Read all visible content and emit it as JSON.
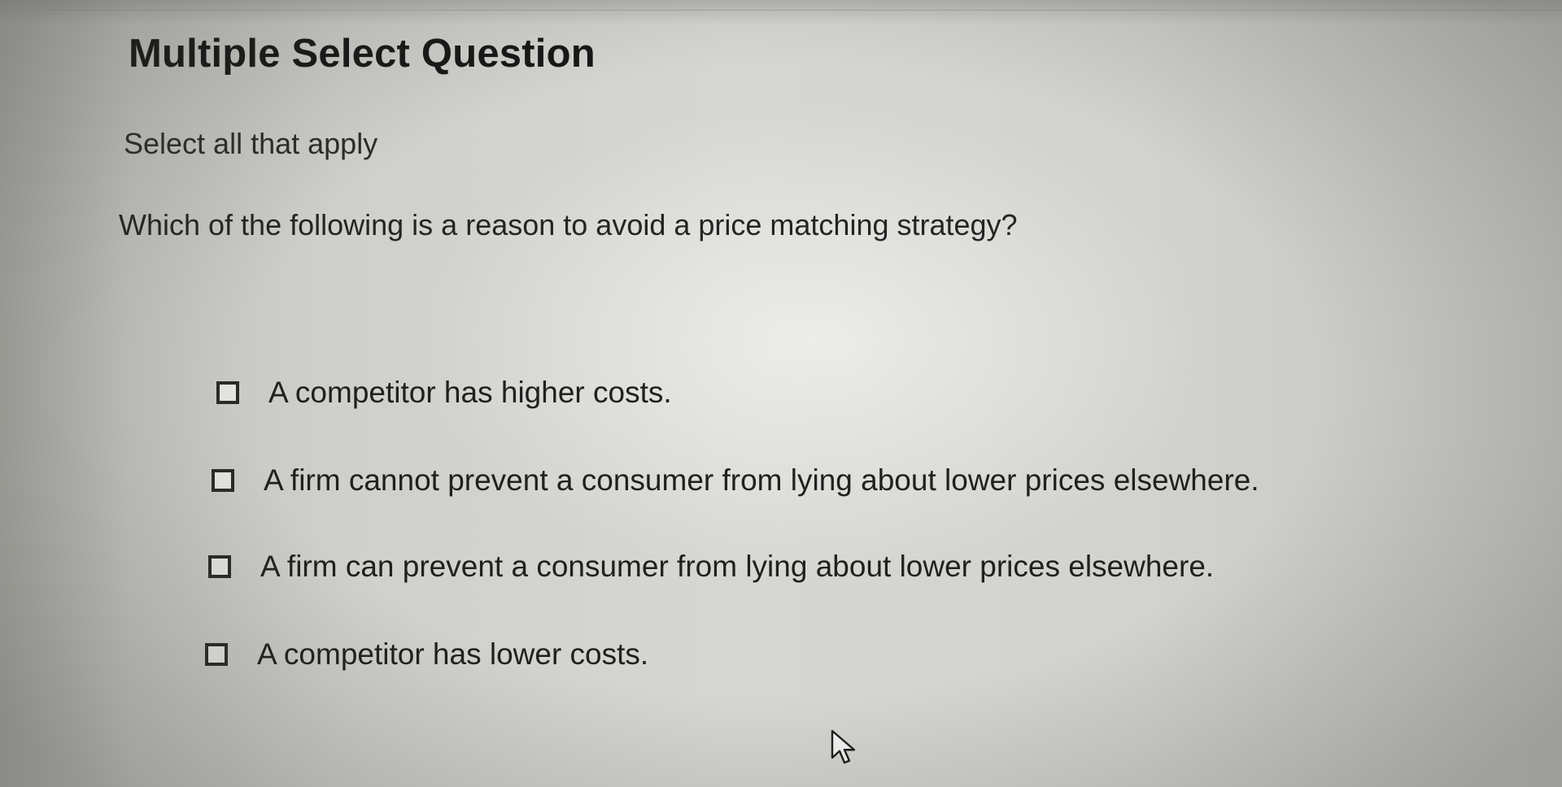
{
  "question": {
    "type_label": "Multiple Select Question",
    "instruction": "Select all that apply",
    "prompt": "Which of the following is a reason to avoid a price matching strategy?",
    "options": [
      {
        "label": "A competitor has higher costs.",
        "checked": false
      },
      {
        "label": "A firm cannot prevent a consumer from lying about lower prices elsewhere.",
        "checked": false
      },
      {
        "label": "A firm can prevent a consumer from lying about lower prices elsewhere.",
        "checked": false
      },
      {
        "label": "A competitor has lower costs.",
        "checked": false
      }
    ]
  },
  "icons": {
    "checkbox": "checkbox-icon",
    "cursor": "mouse-pointer-icon"
  }
}
